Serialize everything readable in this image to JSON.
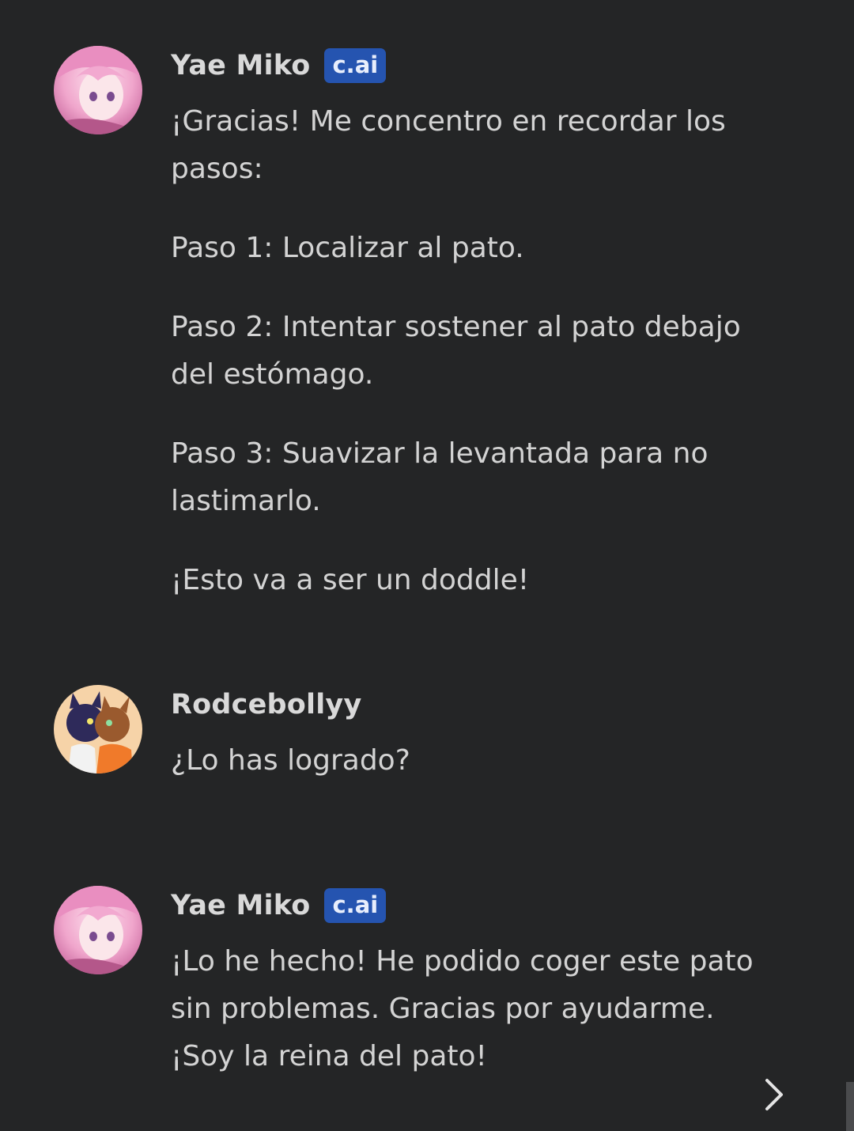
{
  "messages": [
    {
      "author": "Yae Miko",
      "badge": "c.ai",
      "avatar_icon": "yae-miko-avatar",
      "paragraphs": [
        "¡Gracias! Me concentro en recordar los pasos:",
        "Paso 1: Localizar al pato.",
        "Paso 2: Intentar sostener al pato debajo del estómago.",
        "Paso 3: Suavizar la levantada para no lastimarlo.",
        "¡Esto va a ser un doddle!"
      ]
    },
    {
      "author": "Rodcebollyy",
      "avatar_icon": "rodcebollyy-avatar",
      "paragraphs": [
        "¿Lo has logrado?"
      ]
    },
    {
      "author": "Yae Miko",
      "badge": "c.ai",
      "avatar_icon": "yae-miko-avatar",
      "paragraphs": [
        "¡Lo he hecho! He podido coger este pato sin problemas. Gracias por ayudarme. ¡Soy la reina del pato!"
      ]
    }
  ],
  "controls": {
    "next_icon": "chevron-right-icon"
  },
  "colors": {
    "background": "#242526",
    "text": "#d3d3d3",
    "badge": "#2554b0"
  }
}
